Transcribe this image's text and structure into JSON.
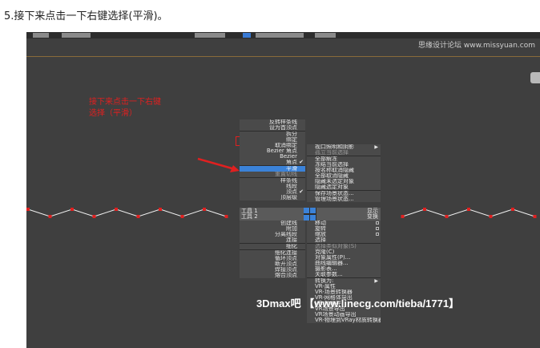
{
  "caption": "5.接下来点击一下右键选择(平滑)。",
  "viewport": {
    "toolbar_icons": [
      "toolbar-button",
      "toolbar-button",
      "toolbar-button",
      "toolbar-button-active",
      "toolbar-button",
      "toolbar-button"
    ],
    "watermark_top": "思缘设计论坛 www.missyuan.com"
  },
  "annotation": "接下来点击一下右键选择（平滑）",
  "quad_left_top": [
    {
      "label": "反转样条线"
    },
    {
      "label": "设为首顶点"
    },
    {
      "label": "拆分"
    },
    {
      "label": "绑定"
    },
    {
      "label": "取消绑定"
    },
    {
      "label": "Bezier 角点"
    },
    {
      "label": "Bezier"
    },
    {
      "label": "角点",
      "check": true
    },
    {
      "label": "平滑",
      "selected": true
    },
    {
      "label": "重置切线",
      "dim": true
    },
    {
      "label": "样条线"
    },
    {
      "label": "线段"
    },
    {
      "label": "顶点",
      "check": true
    },
    {
      "label": "顶层级"
    }
  ],
  "quad_right_top": [
    {
      "label": "视口照明和阴影",
      "submenu": true
    },
    {
      "label": "孤立当前选择",
      "dim": true
    },
    {
      "label": "全部解冻"
    },
    {
      "label": "冻结当前选择"
    },
    {
      "label": "按名称取消隐藏"
    },
    {
      "label": "全部取消隐藏"
    },
    {
      "label": "隐藏未选定对象"
    },
    {
      "label": "隐藏选定对象"
    },
    {
      "label": "保存场景状态..."
    },
    {
      "label": "管理场景状态..."
    }
  ],
  "quad_header": {
    "left_label": "工具 1",
    "left_label2": "工具 2",
    "right_label": "显示",
    "right_label2": "变换"
  },
  "quad_left_bottom": [
    {
      "label": "创建线"
    },
    {
      "label": "附加"
    },
    {
      "label": "分离线段"
    },
    {
      "label": "连接"
    },
    {
      "label": "细化"
    },
    {
      "label": "细化连接"
    },
    {
      "label": "循环顶点"
    },
    {
      "label": "断开顶点"
    },
    {
      "label": "焊接顶点"
    },
    {
      "label": "熔合顶点"
    }
  ],
  "quad_right_bottom": [
    {
      "label": "移动",
      "opt": true
    },
    {
      "label": "旋转",
      "opt": true
    },
    {
      "label": "缩放",
      "opt": true
    },
    {
      "label": "选择"
    },
    {
      "label": "选择类似对象(S)",
      "dim": true
    },
    {
      "label": "克隆(C)"
    },
    {
      "label": "对象属性(P)..."
    },
    {
      "label": "曲线编辑器..."
    },
    {
      "label": "摄影表..."
    },
    {
      "label": "关联参数..."
    },
    {
      "label": "转换为:",
      "submenu": true
    },
    {
      "label": "VR-属性"
    },
    {
      "label": "VR-场景转换器"
    },
    {
      "label": "VR-网格体导出"
    },
    {
      "label": "VR-帧缓存"
    },
    {
      "label": "VR场景导出"
    },
    {
      "label": "VR场景动画导出"
    },
    {
      "label": "VR-物理到VRay材质转换器"
    }
  ],
  "watermark_bottom": "3Dmax吧 【www.linecg.com/tieba/1771】",
  "colors": {
    "viewport_bg": "#3f3f3f",
    "menu_bg": "#4a4a4a",
    "highlight": "#3b82d8",
    "annotation": "#e02020",
    "spline_vertex": "#e02020"
  },
  "spline_points_y": [
    "low",
    "high",
    "low",
    "high",
    "low",
    "high",
    "low",
    "high",
    "low",
    "high",
    "low",
    "high",
    "low",
    "high",
    "low",
    "high",
    "low",
    "high",
    "low",
    "high",
    "low",
    "high",
    "low",
    "high"
  ]
}
